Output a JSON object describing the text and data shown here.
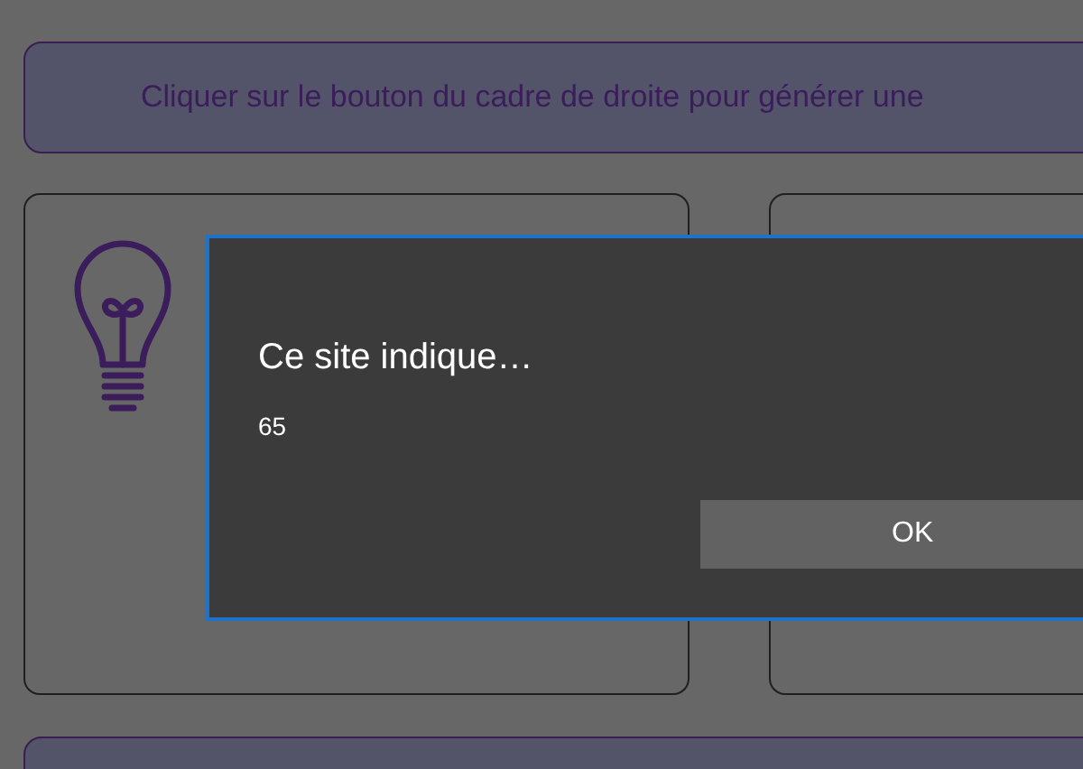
{
  "banner": {
    "text": "Cliquer sur le bouton du cadre de droite pour générer une"
  },
  "dialog": {
    "title": "Ce site indique…",
    "message": "65",
    "button": "OK"
  }
}
